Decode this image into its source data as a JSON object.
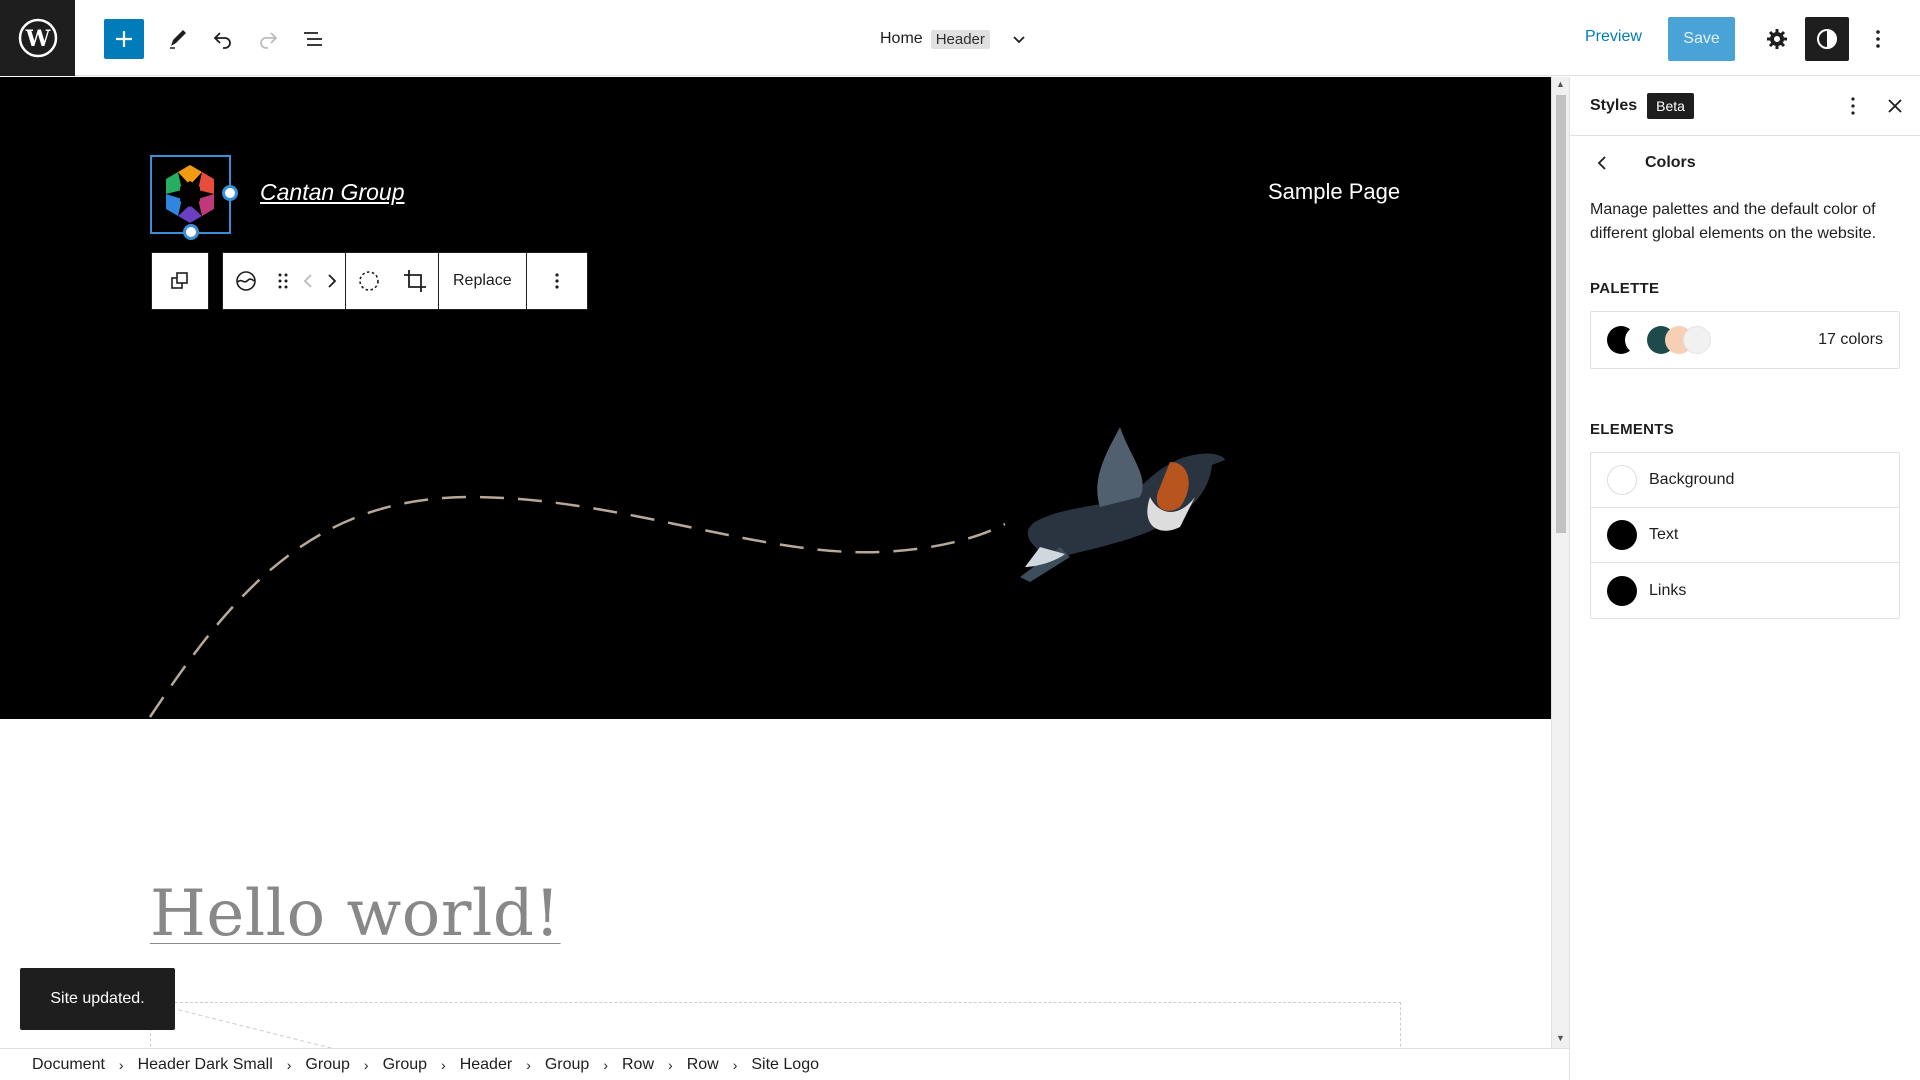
{
  "header": {
    "breadcrumb_page": "Home",
    "template_part": "Header",
    "preview_label": "Preview",
    "save_label": "Save"
  },
  "canvas": {
    "site_title": "Cantan Group",
    "nav_item": "Sample Page",
    "toolbar_replace": "Replace",
    "post_title": "Hello world!"
  },
  "snackbar": {
    "message": "Site updated."
  },
  "breadcrumbs": [
    "Document",
    "Header Dark Small",
    "Group",
    "Group",
    "Header",
    "Group",
    "Row",
    "Row",
    "Site Logo"
  ],
  "sidebar": {
    "title": "Styles",
    "badge": "Beta",
    "section_title": "Colors",
    "description": "Manage palettes and the default color of different global elements on the website.",
    "palette_label": "PALETTE",
    "palette_count": "17 colors",
    "palette_swatches": [
      "#000000",
      "#ffffff",
      "#1f4a4c",
      "#f6cfb5",
      "#f1f1f1"
    ],
    "elements_label": "ELEMENTS",
    "elements": [
      {
        "label": "Background",
        "color": "#ffffff"
      },
      {
        "label": "Text",
        "color": "#000000"
      },
      {
        "label": "Links",
        "color": "#000000"
      }
    ]
  },
  "colors": {
    "accent": "#007cba",
    "dark": "#1e1e1e",
    "selection": "#3a8fd6"
  }
}
